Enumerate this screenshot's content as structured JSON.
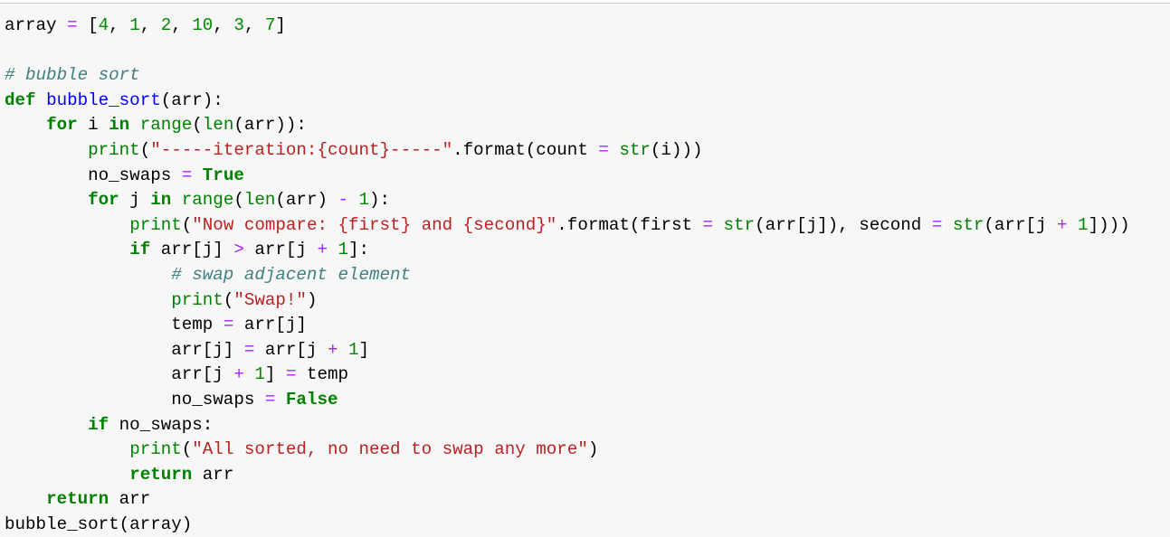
{
  "editor": {
    "language": "python",
    "colors": {
      "background": "#f7f7f7",
      "border": "#cfcfcf",
      "keyword": "#008000",
      "builtin": "#008000",
      "function_name": "#0000ff",
      "string": "#ba2121",
      "comment": "#408080",
      "operator": "#aa22ff",
      "number": "#008800",
      "text": "#000000"
    },
    "lines": [
      {
        "indent": "",
        "tokens": [
          {
            "t": "tx",
            "v": "array "
          },
          {
            "t": "op",
            "v": "="
          },
          {
            "t": "tx",
            "v": " ["
          },
          {
            "t": "nm",
            "v": "4"
          },
          {
            "t": "tx",
            "v": ", "
          },
          {
            "t": "nm",
            "v": "1"
          },
          {
            "t": "tx",
            "v": ", "
          },
          {
            "t": "nm",
            "v": "2"
          },
          {
            "t": "tx",
            "v": ", "
          },
          {
            "t": "nm",
            "v": "10"
          },
          {
            "t": "tx",
            "v": ", "
          },
          {
            "t": "nm",
            "v": "3"
          },
          {
            "t": "tx",
            "v": ", "
          },
          {
            "t": "nm",
            "v": "7"
          },
          {
            "t": "tx",
            "v": "]"
          }
        ]
      },
      {
        "indent": "",
        "tokens": []
      },
      {
        "indent": "",
        "tokens": [
          {
            "t": "cm",
            "v": "# bubble sort"
          }
        ]
      },
      {
        "indent": "",
        "tokens": [
          {
            "t": "kw",
            "v": "def"
          },
          {
            "t": "tx",
            "v": " "
          },
          {
            "t": "fn",
            "v": "bubble_sort"
          },
          {
            "t": "tx",
            "v": "(arr):"
          }
        ]
      },
      {
        "indent": "    ",
        "tokens": [
          {
            "t": "kw",
            "v": "for"
          },
          {
            "t": "tx",
            "v": " i "
          },
          {
            "t": "kw",
            "v": "in"
          },
          {
            "t": "tx",
            "v": " "
          },
          {
            "t": "bi",
            "v": "range"
          },
          {
            "t": "tx",
            "v": "("
          },
          {
            "t": "bi",
            "v": "len"
          },
          {
            "t": "tx",
            "v": "(arr)):"
          }
        ]
      },
      {
        "indent": "        ",
        "tokens": [
          {
            "t": "bi",
            "v": "print"
          },
          {
            "t": "tx",
            "v": "("
          },
          {
            "t": "st",
            "v": "\"-----iteration:{count}-----\""
          },
          {
            "t": "tx",
            "v": ".format(count "
          },
          {
            "t": "op",
            "v": "="
          },
          {
            "t": "tx",
            "v": " "
          },
          {
            "t": "bi",
            "v": "str"
          },
          {
            "t": "tx",
            "v": "(i)))"
          }
        ]
      },
      {
        "indent": "        ",
        "tokens": [
          {
            "t": "tx",
            "v": "no_swaps "
          },
          {
            "t": "op",
            "v": "="
          },
          {
            "t": "tx",
            "v": " "
          },
          {
            "t": "kw",
            "v": "True"
          }
        ]
      },
      {
        "indent": "        ",
        "tokens": [
          {
            "t": "kw",
            "v": "for"
          },
          {
            "t": "tx",
            "v": " j "
          },
          {
            "t": "kw",
            "v": "in"
          },
          {
            "t": "tx",
            "v": " "
          },
          {
            "t": "bi",
            "v": "range"
          },
          {
            "t": "tx",
            "v": "("
          },
          {
            "t": "bi",
            "v": "len"
          },
          {
            "t": "tx",
            "v": "(arr) "
          },
          {
            "t": "op",
            "v": "-"
          },
          {
            "t": "tx",
            "v": " "
          },
          {
            "t": "nm",
            "v": "1"
          },
          {
            "t": "tx",
            "v": "):"
          }
        ]
      },
      {
        "indent": "            ",
        "tokens": [
          {
            "t": "bi",
            "v": "print"
          },
          {
            "t": "tx",
            "v": "("
          },
          {
            "t": "st",
            "v": "\"Now compare: {first} and {second}\""
          },
          {
            "t": "tx",
            "v": ".format(first "
          },
          {
            "t": "op",
            "v": "="
          },
          {
            "t": "tx",
            "v": " "
          },
          {
            "t": "bi",
            "v": "str"
          },
          {
            "t": "tx",
            "v": "(arr[j]), second "
          },
          {
            "t": "op",
            "v": "="
          },
          {
            "t": "tx",
            "v": " "
          },
          {
            "t": "bi",
            "v": "str"
          },
          {
            "t": "tx",
            "v": "(arr[j "
          },
          {
            "t": "op",
            "v": "+"
          },
          {
            "t": "tx",
            "v": " "
          },
          {
            "t": "nm",
            "v": "1"
          },
          {
            "t": "tx",
            "v": "])))"
          }
        ]
      },
      {
        "indent": "            ",
        "tokens": [
          {
            "t": "kw",
            "v": "if"
          },
          {
            "t": "tx",
            "v": " arr[j] "
          },
          {
            "t": "op",
            "v": ">"
          },
          {
            "t": "tx",
            "v": " arr[j "
          },
          {
            "t": "op",
            "v": "+"
          },
          {
            "t": "tx",
            "v": " "
          },
          {
            "t": "nm",
            "v": "1"
          },
          {
            "t": "tx",
            "v": "]:"
          }
        ]
      },
      {
        "indent": "                ",
        "tokens": [
          {
            "t": "cm",
            "v": "# swap adjacent element"
          }
        ]
      },
      {
        "indent": "                ",
        "tokens": [
          {
            "t": "bi",
            "v": "print"
          },
          {
            "t": "tx",
            "v": "("
          },
          {
            "t": "st",
            "v": "\"Swap!\""
          },
          {
            "t": "tx",
            "v": ")"
          }
        ]
      },
      {
        "indent": "                ",
        "tokens": [
          {
            "t": "tx",
            "v": "temp "
          },
          {
            "t": "op",
            "v": "="
          },
          {
            "t": "tx",
            "v": " arr[j]"
          }
        ]
      },
      {
        "indent": "                ",
        "tokens": [
          {
            "t": "tx",
            "v": "arr[j] "
          },
          {
            "t": "op",
            "v": "="
          },
          {
            "t": "tx",
            "v": " arr[j "
          },
          {
            "t": "op",
            "v": "+"
          },
          {
            "t": "tx",
            "v": " "
          },
          {
            "t": "nm",
            "v": "1"
          },
          {
            "t": "tx",
            "v": "]"
          }
        ]
      },
      {
        "indent": "                ",
        "tokens": [
          {
            "t": "tx",
            "v": "arr[j "
          },
          {
            "t": "op",
            "v": "+"
          },
          {
            "t": "tx",
            "v": " "
          },
          {
            "t": "nm",
            "v": "1"
          },
          {
            "t": "tx",
            "v": "] "
          },
          {
            "t": "op",
            "v": "="
          },
          {
            "t": "tx",
            "v": " temp"
          }
        ]
      },
      {
        "indent": "                ",
        "tokens": [
          {
            "t": "tx",
            "v": "no_swaps "
          },
          {
            "t": "op",
            "v": "="
          },
          {
            "t": "tx",
            "v": " "
          },
          {
            "t": "kw",
            "v": "False"
          }
        ]
      },
      {
        "indent": "        ",
        "tokens": [
          {
            "t": "kw",
            "v": "if"
          },
          {
            "t": "tx",
            "v": " no_swaps:"
          }
        ]
      },
      {
        "indent": "            ",
        "tokens": [
          {
            "t": "bi",
            "v": "print"
          },
          {
            "t": "tx",
            "v": "("
          },
          {
            "t": "st",
            "v": "\"All sorted, no need to swap any more\""
          },
          {
            "t": "tx",
            "v": ")"
          }
        ]
      },
      {
        "indent": "            ",
        "tokens": [
          {
            "t": "kw",
            "v": "return"
          },
          {
            "t": "tx",
            "v": " arr"
          }
        ]
      },
      {
        "indent": "    ",
        "tokens": [
          {
            "t": "kw",
            "v": "return"
          },
          {
            "t": "tx",
            "v": " arr"
          }
        ]
      },
      {
        "indent": "",
        "tokens": [
          {
            "t": "tx",
            "v": "bubble_sort(array)"
          }
        ]
      }
    ]
  }
}
